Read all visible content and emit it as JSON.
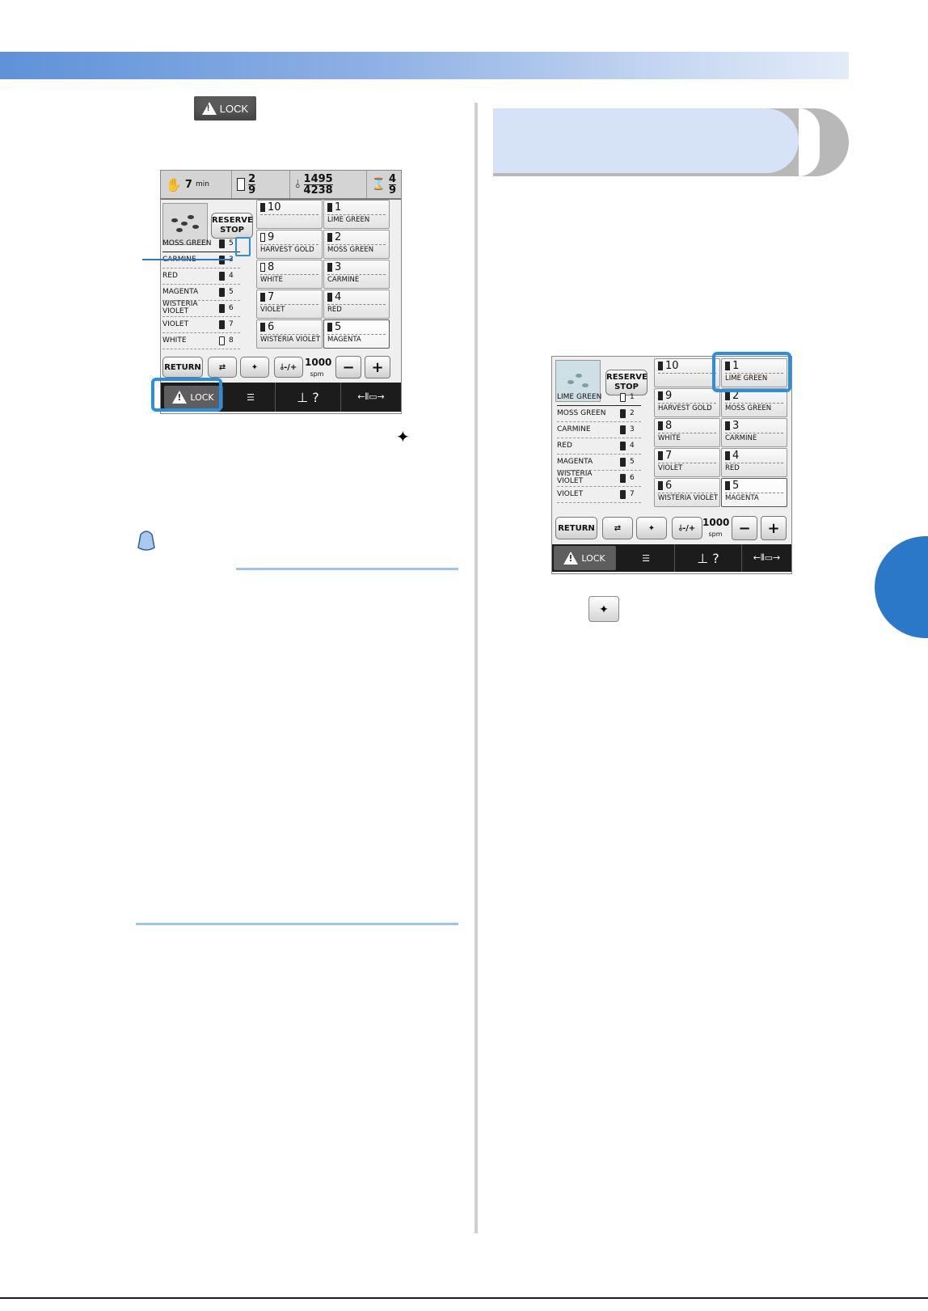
{
  "inline_button": {
    "label": "LOCK"
  },
  "panel_left": {
    "status": {
      "time1": "7",
      "unit_min": "min",
      "colors_num": "2",
      "colors_den": "9",
      "stitch_num": "1495",
      "stitch_den": "4238",
      "time2_num": "4",
      "time2_den": "9"
    },
    "reserve_label": [
      "RESERVE",
      "STOP"
    ],
    "color_list": [
      {
        "name": "MOSS GREEN",
        "num": "5",
        "hollow": false
      },
      {
        "name": "CARMINE",
        "num": "3",
        "hollow": false
      },
      {
        "name": "RED",
        "num": "4",
        "hollow": false
      },
      {
        "name": "MAGENTA",
        "num": "5",
        "hollow": false
      },
      {
        "name": "WISTERIA VIOLET",
        "num": "6",
        "hollow": false
      },
      {
        "name": "VIOLET",
        "num": "7",
        "hollow": false
      },
      {
        "name": "WHITE",
        "num": "8",
        "hollow": true
      }
    ],
    "cells": [
      {
        "n": "10",
        "label": "",
        "hollow": false
      },
      {
        "n": "1",
        "label": "LIME GREEN",
        "hollow": false
      },
      {
        "n": "9",
        "label": "HARVEST GOLD",
        "hollow": true
      },
      {
        "n": "2",
        "label": "MOSS GREEN",
        "hollow": false
      },
      {
        "n": "8",
        "label": "WHITE",
        "hollow": true
      },
      {
        "n": "3",
        "label": "CARMINE",
        "hollow": false
      },
      {
        "n": "7",
        "label": "VIOLET",
        "hollow": false
      },
      {
        "n": "4",
        "label": "RED",
        "hollow": false
      },
      {
        "n": "6",
        "label": "WISTERIA VIOLET",
        "hollow": false
      },
      {
        "n": "5",
        "label": "MAGENTA",
        "hollow": false
      }
    ],
    "return_label": "RETURN",
    "speed": "1000",
    "speed_unit": "spm",
    "lock_label": "LOCK"
  },
  "panel_right": {
    "reserve_label": [
      "RESERVE",
      "STOP"
    ],
    "color_list": [
      {
        "name": "LIME GREEN",
        "num": "1",
        "hollow": true
      },
      {
        "name": "MOSS GREEN",
        "num": "2",
        "hollow": false
      },
      {
        "name": "CARMINE",
        "num": "3",
        "hollow": false
      },
      {
        "name": "RED",
        "num": "4",
        "hollow": false
      },
      {
        "name": "MAGENTA",
        "num": "5",
        "hollow": false
      },
      {
        "name": "WISTERIA VIOLET",
        "num": "6",
        "hollow": false
      },
      {
        "name": "VIOLET",
        "num": "7",
        "hollow": false
      }
    ],
    "cells": [
      {
        "n": "10",
        "label": "",
        "hollow": false
      },
      {
        "n": "1",
        "label": "LIME GREEN",
        "hollow": false
      },
      {
        "n": "9",
        "label": "HARVEST GOLD",
        "hollow": false
      },
      {
        "n": "2",
        "label": "MOSS GREEN",
        "hollow": false
      },
      {
        "n": "8",
        "label": "WHITE",
        "hollow": false
      },
      {
        "n": "3",
        "label": "CARMINE",
        "hollow": false
      },
      {
        "n": "7",
        "label": "VIOLET",
        "hollow": false
      },
      {
        "n": "4",
        "label": "RED",
        "hollow": false
      },
      {
        "n": "6",
        "label": "WISTERIA VIOLET",
        "hollow": false
      },
      {
        "n": "5",
        "label": "MAGENTA",
        "hollow": false
      }
    ],
    "return_label": "RETURN",
    "speed": "1000",
    "speed_unit": "spm",
    "lock_label": "LOCK"
  },
  "colors": {
    "header_blue": "#5f92d8",
    "highlight": "#2c8ee0",
    "side_tab": "#2b78c8"
  },
  "icons": [
    "warning-icon",
    "bell-icon",
    "thread-spool-icon",
    "magic-wand-icon",
    "hourglass-icon",
    "needle-icon",
    "presser-foot-icon"
  ]
}
